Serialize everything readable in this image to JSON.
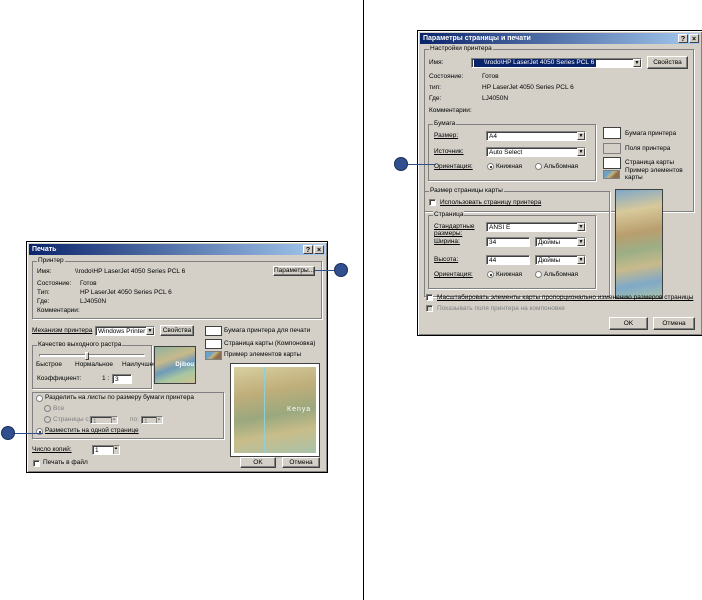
{
  "left_dialog": {
    "title": "Печать",
    "help_btn": "?",
    "close_btn": "×",
    "printer_group": "Принтер",
    "name_label": "Имя:",
    "name_value": "\\\\rodo\\HP LaserJet 4050 Series PCL 6",
    "properties_button": "Параметры...",
    "status_label": "Состояние:",
    "status_value": "Готов",
    "type_label": "Тип:",
    "type_value": "HP LaserJet 4050 Series PCL 6",
    "where_label": "Где:",
    "where_value": "LJ4050N",
    "comment_label": "Комментарии:",
    "engine_label": "Механизм принтера",
    "engine_value": "Windows Printer",
    "engine_properties_button": "Свойства",
    "quality_group": "Качество выходного растра",
    "quality_fast": "Быстрое",
    "quality_normal": "Нормальное",
    "quality_best": "Наилучшее",
    "quality_level": 0.45,
    "ratio_label": "Коэффициент:",
    "ratio_prefix": "1 :",
    "ratio_value": "3",
    "map_label_sample": "Djibou",
    "legend_paper": "Бумага принтера для печати",
    "legend_map_page": "Страница карты (Компоновка)",
    "legend_sample": "Пример элементов карты",
    "preview_label": "Кеnуа",
    "tile_option": "Разделить на листы по размеру бумаги принтера",
    "all_option": "Все",
    "pages_option": "Страницы с:",
    "pages_to": "по:",
    "pages_from_value": "1",
    "pages_to_value": "1",
    "fit_option": "Разместить на одной странице",
    "copies_label": "Число копий:",
    "copies_value": "1",
    "print_to_file": "Печать в файл",
    "ok_button": "OK",
    "cancel_button": "Отмена"
  },
  "right_dialog": {
    "title": "Параметры страницы и печати",
    "help_btn": "?",
    "close_btn": "×",
    "printer_group": "Настройки принтера",
    "name_label": "Имя:",
    "name_value": "\\\\rodo\\HP LaserJet 4050 Series PCL 6",
    "properties_button": "Свойства",
    "status_label": "Состояние:",
    "status_value": "Готов",
    "type_label": "тип:",
    "type_value": "HP LaserJet 4050 Series PCL 6",
    "where_label": "Где:",
    "where_value": "LJ4050N",
    "comment_label": "Комментарии:",
    "paper_group": "Бумага",
    "size_label": "Размер:",
    "size_value": "A4",
    "source_label": "Источник:",
    "source_value": "Auto Select",
    "orientation_label": "Ориентация:",
    "portrait": "Книжная",
    "landscape": "Альбомная",
    "legend_printer_paper": "Бумага принтера",
    "legend_printer_margins": "Поля принтера",
    "legend_map_page": "Страница карты",
    "legend_sample": "Пример элементов карты",
    "map_page_group": "Размер страницы карты",
    "use_printer_page": "Использовать страницу принтера",
    "page_group": "Страница",
    "std_sizes_label": "Стандартные размеры:",
    "std_size_value": "ANSI E",
    "width_label": "Ширина:",
    "width_value": "34",
    "width_units": "Дюймы",
    "height_label": "Высота:",
    "height_value": "44",
    "height_units": "Дюймы",
    "orientation2_label": "Ориентация:",
    "portrait2": "Книжная",
    "landscape2": "Альбомная",
    "scale_elements": "Масштабировать элементы карты пропорционально изменению размеров страницы",
    "show_margins": "Показывать поля принтера на компоновке",
    "ok_button": "OK",
    "cancel_button": "Отмена"
  }
}
